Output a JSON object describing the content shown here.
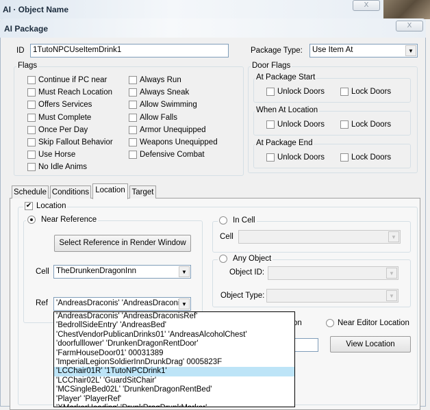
{
  "window": {
    "title": "AI · Object Name",
    "close": "X"
  },
  "dialog": {
    "title": "AI Package",
    "close": "X"
  },
  "id": {
    "label": "ID",
    "value": "1TutoNPCUseItemDrink1"
  },
  "package_type": {
    "label": "Package Type:",
    "value": "Use Item At"
  },
  "flags": {
    "title": "Flags",
    "col1": [
      {
        "label": "Continue if PC near",
        "checked": false
      },
      {
        "label": "Must Reach Location",
        "checked": false
      },
      {
        "label": "Offers Services",
        "checked": false
      },
      {
        "label": "Must Complete",
        "checked": false
      },
      {
        "label": "Once Per Day",
        "checked": false
      },
      {
        "label": "Skip Fallout Behavior",
        "checked": false
      },
      {
        "label": "Use Horse",
        "checked": false
      },
      {
        "label": "No Idle Anims",
        "checked": false
      }
    ],
    "col2": [
      {
        "label": "Always Run",
        "checked": false
      },
      {
        "label": "Always Sneak",
        "checked": false
      },
      {
        "label": "Allow Swimming",
        "checked": false
      },
      {
        "label": "Allow Falls",
        "checked": false
      },
      {
        "label": "Armor Unequipped",
        "checked": false
      },
      {
        "label": "Weapons Unequipped",
        "checked": false
      },
      {
        "label": "Defensive Combat",
        "checked": false
      }
    ]
  },
  "door_flags": {
    "title": "Door Flags",
    "groups": [
      {
        "title": "At Package Start",
        "unlock": "Unlock Doors",
        "lock": "Lock Doors"
      },
      {
        "title": "When At Location",
        "unlock": "Unlock Doors",
        "lock": "Lock Doors"
      },
      {
        "title": "At Package End",
        "unlock": "Unlock Doors",
        "lock": "Lock Doors"
      }
    ]
  },
  "tabs": [
    "Schedule",
    "Conditions",
    "Location",
    "Target"
  ],
  "active_tab": "Location",
  "location": {
    "label": "Location",
    "checked": true,
    "near_reference": {
      "label": "Near Reference",
      "select_button": "Select Reference in Render Window",
      "cell_label": "Cell",
      "cell_value": "TheDrunkenDragonInn",
      "ref_label": "Ref",
      "ref_value": "'AndreasDraconis' 'AndreasDraconisR"
    },
    "in_cell": {
      "label": "In Cell",
      "cell_label": "Cell"
    },
    "any_object": {
      "label": "Any Object",
      "object_id_label": "Object ID:",
      "object_type_label": "Object Type:"
    },
    "partial_radio_label": "on",
    "near_editor": "Near Editor Location",
    "view_location": "View Location"
  },
  "ref_dropdown": {
    "items": [
      "'AndreasDraconis' 'AndreasDraconisRef'",
      "'BedrollSideEntry' 'AndreasBed'",
      "'ChestVendorPublicanDrinks01' 'AndreasAlcoholChest'",
      "'doorfulllower' 'DrunkenDragonRentDoor'",
      "'FarmHouseDoor01' 00031389",
      "'ImperialLegionSoldierInnDrunkDrag' 0005823F",
      "'LCChair01R' '1TutoNPCDrink1'",
      "'LCChair02L' 'GuardSitChair'",
      "'MCSingleBed02L' 'DrunkenDragonRentBed'",
      "'Player' 'PlayerRef'",
      "'XMarkerHeading' 'DrunkDragDrunkMarker'"
    ],
    "selected_index": 6
  }
}
